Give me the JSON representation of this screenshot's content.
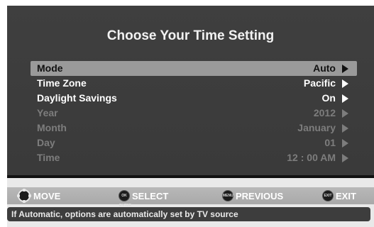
{
  "menu": {
    "title": "Choose Your Time Setting",
    "rows": [
      {
        "label": "Mode",
        "value": "Auto"
      },
      {
        "label": "Time Zone",
        "value": "Pacific"
      },
      {
        "label": "Daylight Savings",
        "value": "On"
      },
      {
        "label": "Year",
        "value": "2012"
      },
      {
        "label": "Month",
        "value": "January"
      },
      {
        "label": "Day",
        "value": "01"
      },
      {
        "label": "Time",
        "value": "12 : 00 AM"
      }
    ]
  },
  "nav": {
    "move": {
      "label": "MOVE",
      "icon": "dpad-icon"
    },
    "select": {
      "label": "SELECT",
      "icon_text": "OK ENTER",
      "icon": "ok-button-icon"
    },
    "previous": {
      "label": "PREVIOUS",
      "icon_text": "MENU",
      "icon": "menu-button-icon"
    },
    "exit": {
      "label": "EXIT",
      "icon_text": "EXIT",
      "icon": "exit-button-icon"
    }
  },
  "info": "If Automatic, options are automatically set by TV source",
  "colors": {
    "panel": "#3d3d3d",
    "selected_row": "#9a9a9a",
    "active_text": "#ffffff",
    "disabled_text": "#7d7d7d",
    "nav_bar": "#b0b0b0"
  }
}
